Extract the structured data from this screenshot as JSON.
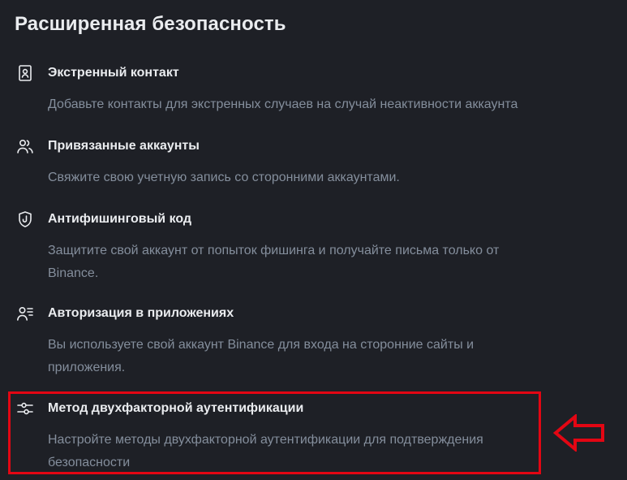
{
  "page": {
    "title": "Расширенная безопасность"
  },
  "items": [
    {
      "icon": "emergency-contact-icon",
      "title": "Экстренный контакт",
      "description": "Добавьте контакты для экстренных случаев на случай неактивности аккаунта"
    },
    {
      "icon": "linked-accounts-icon",
      "title": "Привязанные аккаунты",
      "description": "Свяжите свою учетную запись со сторонними аккаунтами."
    },
    {
      "icon": "anti-phishing-shield-icon",
      "title": "Антифишинговый код",
      "description": "Защитите свой аккаунт от попыток фишинга и получайте письма только от Binance."
    },
    {
      "icon": "app-authorization-icon",
      "title": "Авторизация в приложениях",
      "description": "Вы используете свой аккаунт Binance для входа на сторонние сайты и приложения."
    },
    {
      "icon": "sliders-icon",
      "title": "Метод двухфакторной аутентификации",
      "description": "Настройте методы двухфакторной аутентификации для подтверждения безопасности"
    }
  ],
  "annotation": {
    "highlight_color": "#e30613",
    "highlighted_item": "Метод двухфакторной аутентификации",
    "arrow_icon": "left-arrow-icon"
  },
  "colors": {
    "background": "#1e2026",
    "title_text": "#eaecef",
    "description_text": "#848e9c"
  }
}
